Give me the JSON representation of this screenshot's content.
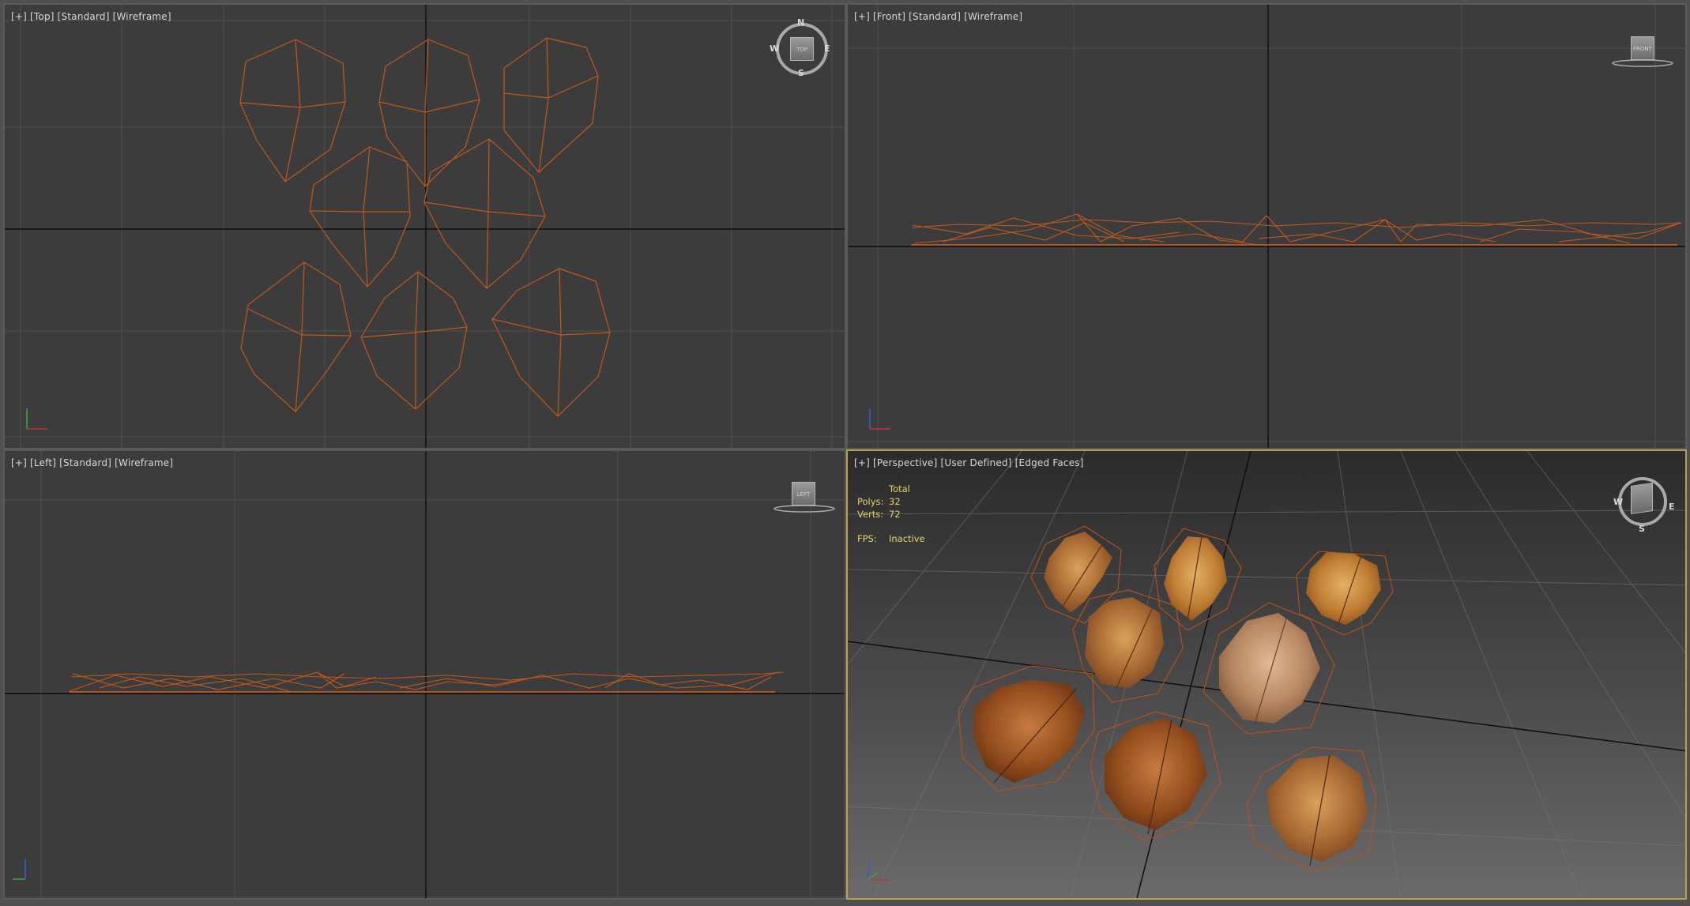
{
  "viewports": {
    "top": {
      "labels": [
        "[+]",
        "[Top]",
        "[Standard]",
        "[Wireframe]"
      ],
      "cube_label": "TOP"
    },
    "front": {
      "labels": [
        "[+]",
        "[Front]",
        "[Standard]",
        "[Wireframe]"
      ],
      "cube_label": "FRONT"
    },
    "left": {
      "labels": [
        "[+]",
        "[Left]",
        "[Standard]",
        "[Wireframe]"
      ],
      "cube_label": "LEFT"
    },
    "perspective": {
      "labels": [
        "[+]",
        "[Perspective]",
        "[User Defined]",
        "[Edged Faces]"
      ],
      "stats": {
        "header": "Total",
        "polys_label": "Polys:",
        "polys_value": "32",
        "verts_label": "Verts:",
        "verts_value": "72",
        "fps_label": "FPS:",
        "fps_value": "Inactive"
      }
    }
  },
  "compass": {
    "n": "N",
    "s": "S",
    "e": "E",
    "w": "W"
  },
  "colors": {
    "viewport_bg": "#3c3c3c",
    "grid": "#4f4f4f",
    "axis_line": "#0e0e0e",
    "wire": "#c0581c",
    "active_border": "#b8a14a",
    "stats_text": "#e6d36a"
  }
}
